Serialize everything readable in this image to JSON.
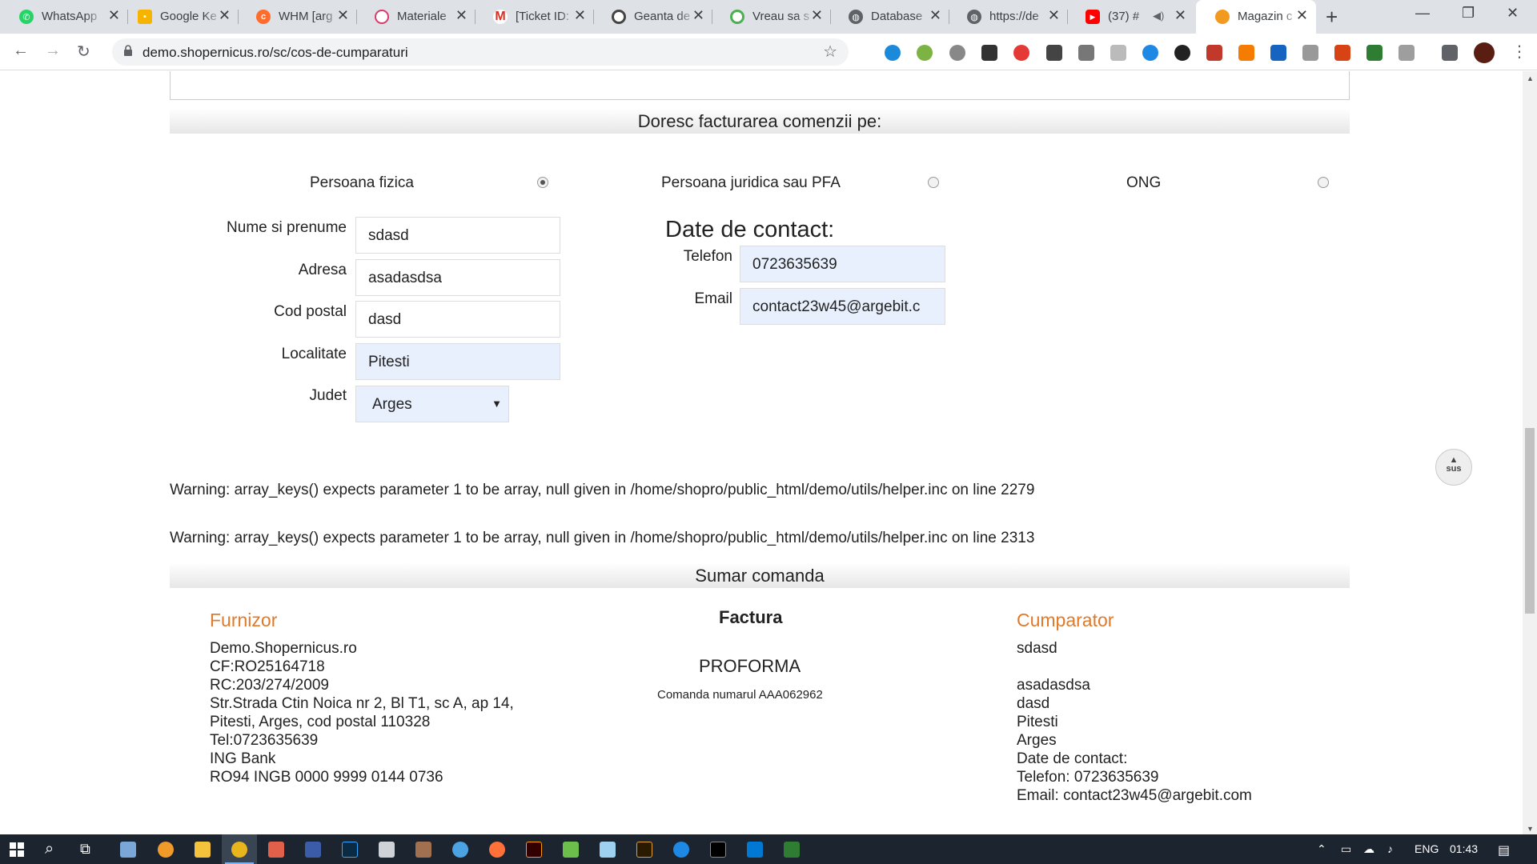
{
  "browser": {
    "tabs": [
      {
        "title": "WhatsApp",
        "icon": "whatsapp-icon",
        "color": "#25d366"
      },
      {
        "title": "Google Ke",
        "icon": "google-keep-icon",
        "color": "#f6b400"
      },
      {
        "title": "WHM [arg",
        "icon": "cpanel-icon",
        "color": "#ff6c2c"
      },
      {
        "title": "Materiale",
        "icon": "materiale-icon",
        "color": "#d93a6b"
      },
      {
        "title": "[Ticket ID:",
        "icon": "gmail-icon",
        "color": "#d93025"
      },
      {
        "title": "Geanta de",
        "icon": "geanta-icon",
        "color": "#444444"
      },
      {
        "title": "Vreau sa s",
        "icon": "vreau-icon",
        "color": "#4caf50"
      },
      {
        "title": "Database",
        "icon": "globe-icon",
        "color": "#5f6368"
      },
      {
        "title": "https://de",
        "icon": "globe-icon",
        "color": "#5f6368"
      },
      {
        "title": "(37) #",
        "icon": "youtube-icon",
        "color": "#ff0000"
      },
      {
        "title": "Magazin c",
        "icon": "magazin-icon",
        "color": "#f29a1f"
      }
    ],
    "url": "demo.shopernicus.ro/sc/cos-de-cumparaturi"
  },
  "billing": {
    "heading": "Doresc facturarea comenzii pe:",
    "options": [
      {
        "label": "Persoana fizica",
        "checked": true
      },
      {
        "label": "Persoana juridica sau PFA",
        "checked": false
      },
      {
        "label": "ONG",
        "checked": false
      }
    ]
  },
  "form": {
    "name_label": "Nume si prenume",
    "name_value": "sdasd",
    "address_label": "Adresa",
    "address_value": "asadasdsa",
    "postal_label": "Cod postal",
    "postal_value": "dasd",
    "city_label": "Localitate",
    "city_value": "Pitesti",
    "county_label": "Judet",
    "county_value": "Arges"
  },
  "contact": {
    "title": "Date de contact:",
    "phone_label": "Telefon",
    "phone_value": "0723635639",
    "email_label": "Email",
    "email_value": "contact23w45@argebit.c"
  },
  "scroll_top_label": "sus",
  "warnings": [
    "Warning: array_keys() expects parameter 1 to be array, null given in /home/shopro/public_html/demo/utils/helper.inc on line 2279",
    "Warning: array_keys() expects parameter 1 to be array, null given in /home/shopro/public_html/demo/utils/helper.inc on line 2313"
  ],
  "summary": {
    "heading": "Sumar comanda",
    "supplier_title": "Furnizor",
    "supplier_lines": [
      "Demo.Shopernicus.ro",
      "CF:RO25164718",
      "RC:203/274/2009",
      "Str.Strada Ctin Noica nr 2, Bl T1, sc A, ap 14,",
      "Pitesti, Arges, cod postal 110328",
      "Tel:0723635639",
      "ING Bank",
      "RO94 INGB 0000 9999 0144 0736"
    ],
    "invoice_title": "Factura",
    "invoice_type": "PROFORMA",
    "order_number": "Comanda numarul AAA062962",
    "buyer_title": "Cumparator",
    "buyer_lines": [
      "sdasd",
      "",
      "asadasdsa",
      "dasd",
      "Pitesti",
      "Arges",
      "Date de contact:",
      "Telefon: 0723635639",
      "Email: contact23w45@argebit.com"
    ]
  },
  "taskbar": {
    "language": "ENG",
    "time": "01:43"
  },
  "colors": {
    "accent_orange": "#e07a2b",
    "autofill_blue": "#e8f0fe",
    "taskbar": "#1c2430"
  }
}
